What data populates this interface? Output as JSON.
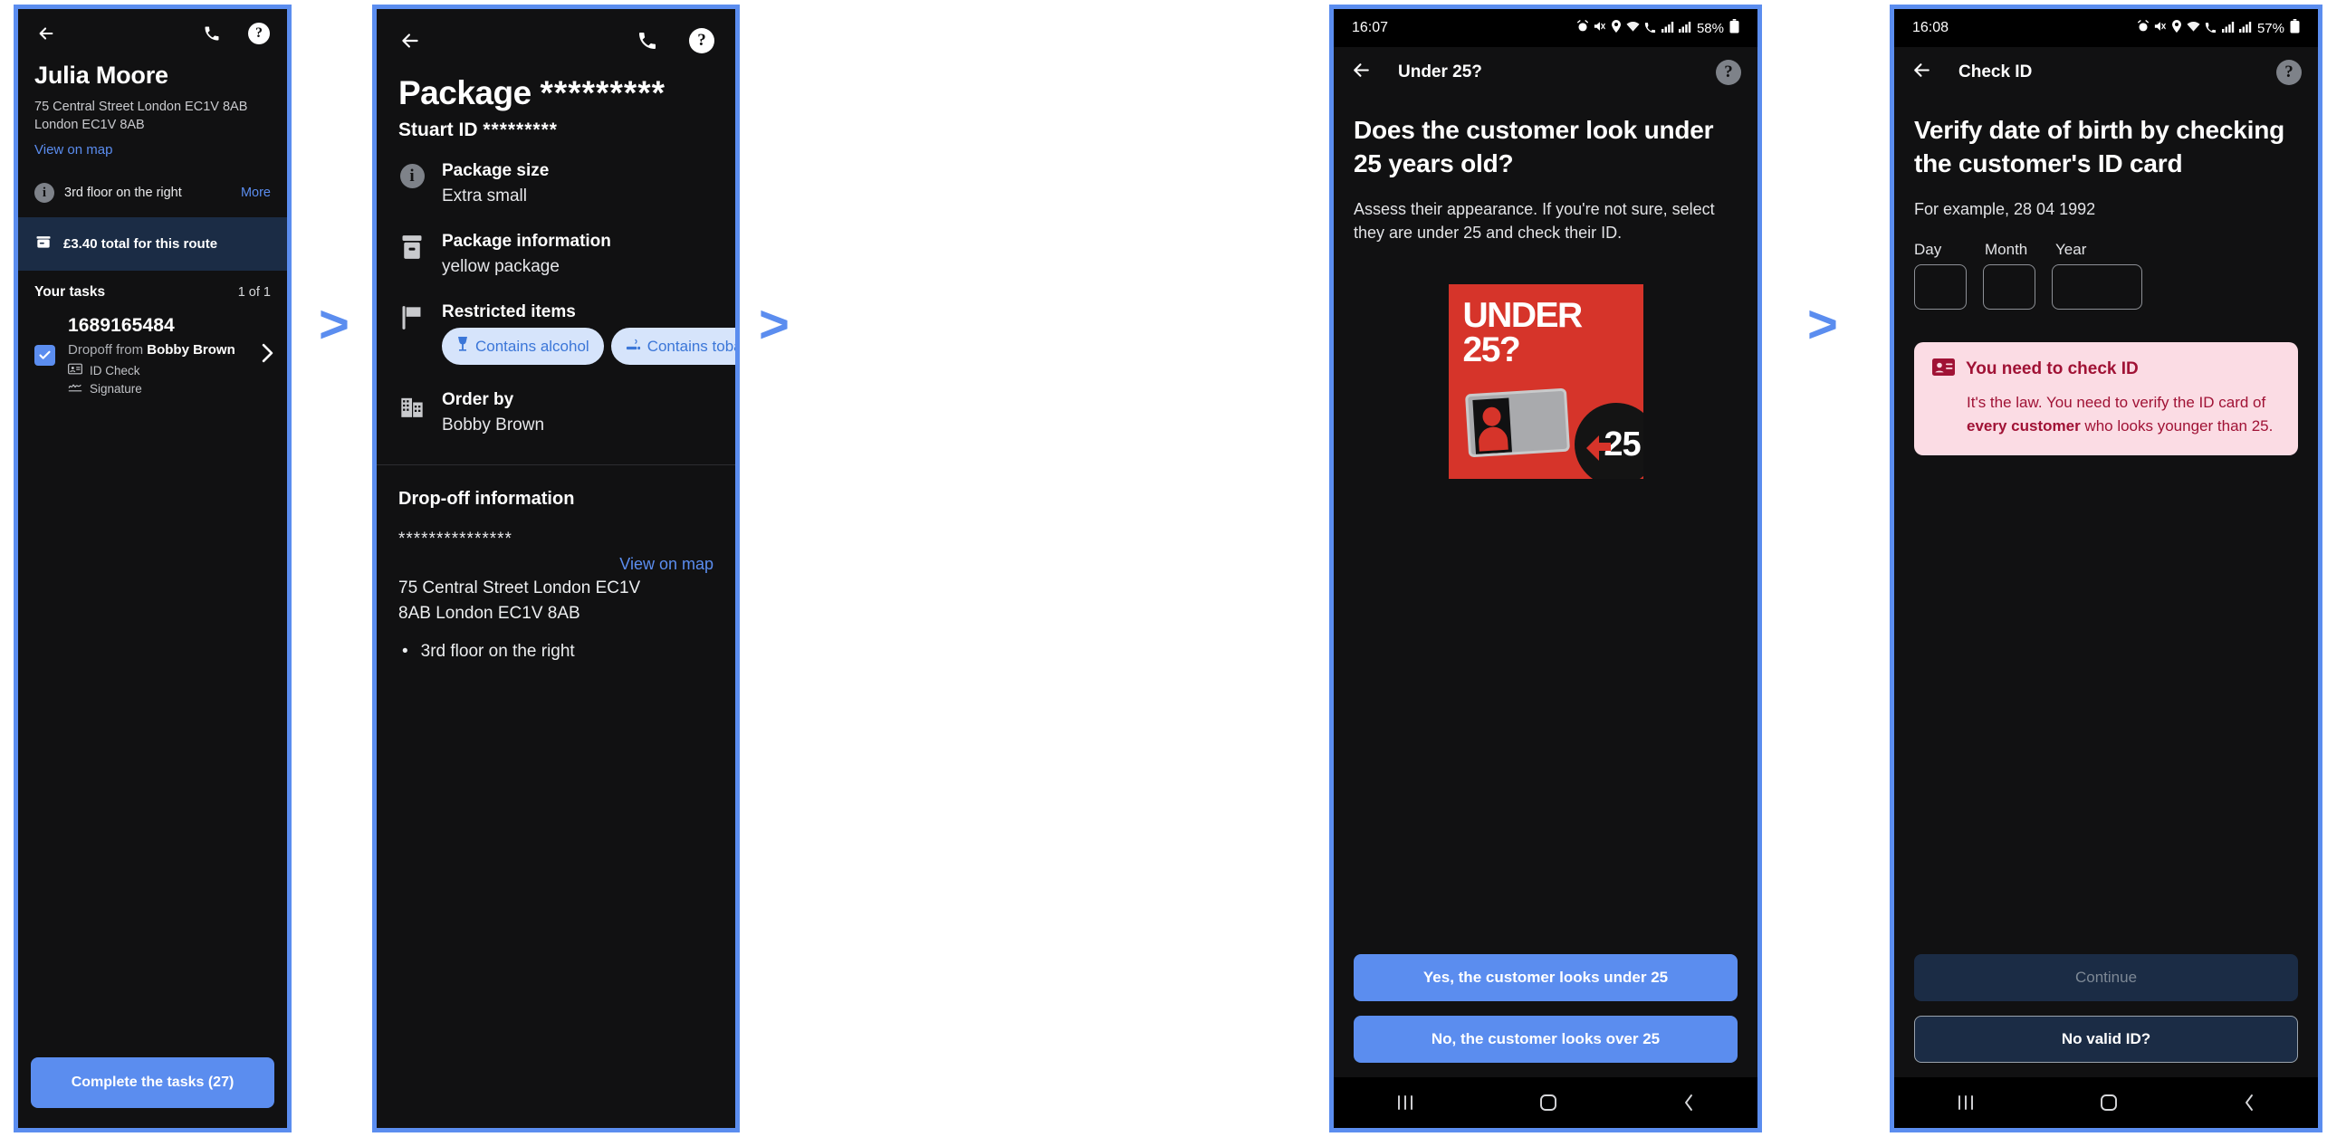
{
  "flow": {
    "arrow_glyph": ">",
    "accent_blue": "#5b8def",
    "alert_red": "#a01235",
    "poster_red": "#d6342a"
  },
  "panel1": {
    "name": "task-details-screen",
    "topbar": {
      "back_icon": "back-arrow-icon",
      "phone_icon": "phone-icon",
      "help_icon": "help-icon"
    },
    "customer_name": "Julia Moore",
    "address_line1": "75 Central Street London EC1V 8AB",
    "address_line2": "London EC1V 8AB",
    "view_on_map": "View on map",
    "note_text": "3rd floor on the right",
    "note_more": "More",
    "total_text": "£3.40 total for this route",
    "tasks_title": "Your tasks",
    "tasks_count": "1 of 1",
    "task": {
      "id": "1689165484",
      "dropoff_prefix": "Dropoff from ",
      "dropoff_name": "Bobby Brown",
      "requirement_1": "ID Check",
      "requirement_2": "Signature"
    },
    "complete_button": "Complete the tasks (27)"
  },
  "panel2": {
    "name": "package-details-screen",
    "topbar": {
      "back_icon": "back-arrow-icon",
      "phone_icon": "phone-icon",
      "help_icon": "help-icon"
    },
    "title_label": "Package",
    "title_value": "*********",
    "stuart_id_label": "Stuart ID",
    "stuart_id_value": "*********",
    "items": [
      {
        "icon": "info-icon",
        "label": "Package size",
        "value": "Extra small"
      },
      {
        "icon": "package-icon",
        "label": "Package information",
        "value": "yellow package"
      },
      {
        "icon": "flag-icon",
        "label": "Restricted items",
        "value": ""
      },
      {
        "icon": "building-icon",
        "label": "Order by",
        "value": "Bobby Brown"
      }
    ],
    "chips": [
      {
        "icon": "wine-glass-icon",
        "label": "Contains alcohol"
      },
      {
        "icon": "cigarette-icon",
        "label": "Contains tobacco"
      }
    ],
    "dropoff_title": "Drop-off information",
    "dropoff_stars": "***************",
    "dropoff_view_map": "View on map",
    "dropoff_address_line1": "75 Central Street London EC1V",
    "dropoff_address_line2": "8AB London EC1V 8AB",
    "dropoff_bullet": "3rd floor on the right"
  },
  "panel3": {
    "name": "under-25-question-screen",
    "status": {
      "time": "16:07",
      "battery": "58%"
    },
    "appbar_title": "Under 25?",
    "heading": "Does the customer look under 25 years old?",
    "body": "Assess their appearance. If you're not sure, select they are under 25 and check their ID.",
    "poster": {
      "line1": "UNDER",
      "line2": "25?",
      "badge": "25"
    },
    "yes_button": "Yes, the customer looks under 25",
    "no_button": "No, the customer looks over 25"
  },
  "panel4": {
    "name": "check-id-screen",
    "status": {
      "time": "16:08",
      "battery": "57%"
    },
    "appbar_title": "Check ID",
    "heading": "Verify date of birth by checking the customer's ID card",
    "example": "For example, 28 04 1992",
    "dob_labels": {
      "day": "Day",
      "month": "Month",
      "year": "Year"
    },
    "dob_values": {
      "day": "",
      "month": "",
      "year": ""
    },
    "alert": {
      "icon": "id-card-icon",
      "title": "You need to check ID",
      "text_1": "It's the law. You need to verify the ID card of ",
      "text_bold": "every customer",
      "text_2": " who looks younger than 25."
    },
    "continue_button": "Continue",
    "no_valid_id_button": "No valid ID?"
  },
  "navbar": {
    "recents_icon": "recents-icon",
    "home_icon": "home-icon",
    "back_icon": "back-icon"
  }
}
